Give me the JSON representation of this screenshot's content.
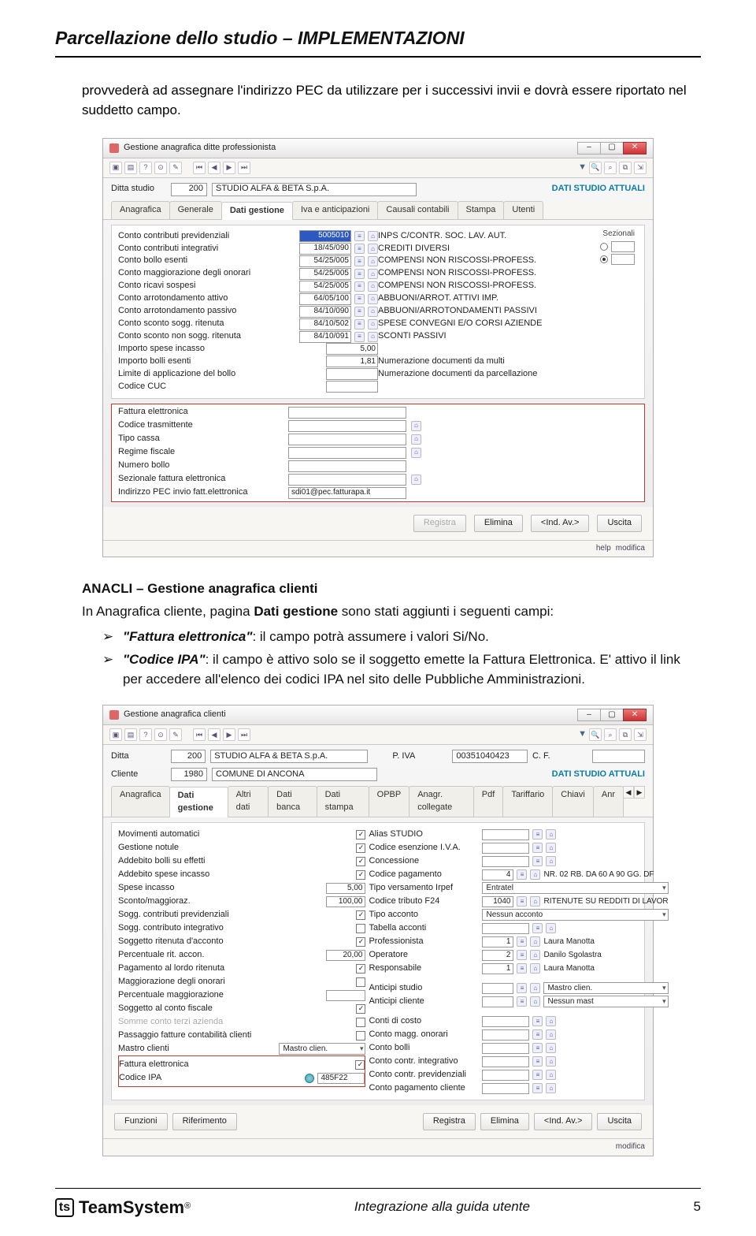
{
  "header": {
    "title": "Parcellazione dello studio – IMPLEMENTAZIONI"
  },
  "intro": "provvederà ad assegnare l'indirizzo PEC da utilizzare per i successivi invii e dovrà essere riportato nel suddetto campo.",
  "shot1": {
    "title": "Gestione anagrafica ditte professionista",
    "ditta_label": "Ditta studio",
    "ditta_code": "200",
    "ditta_name": "STUDIO ALFA & BETA S.p.A.",
    "dati_attuali": "DATI STUDIO ATTUALI",
    "tabs": [
      "Anagrafica",
      "Generale",
      "Dati gestione",
      "Iva e anticipazioni",
      "Causali contabili",
      "Stampa",
      "Utenti"
    ],
    "active_tab": "Dati gestione",
    "rows": [
      {
        "lbl": "Conto contributi previdenziali",
        "code": "5005010",
        "sel": true,
        "desc": "INPS C/CONTR. SOC. LAV. AUT."
      },
      {
        "lbl": "Conto contributi integrativi",
        "code": "18/45/090",
        "desc": "CREDITI DIVERSI"
      },
      {
        "lbl": "Conto bollo esenti",
        "code": "54/25/005",
        "desc": "COMPENSI NON RISCOSSI-PROFESS."
      },
      {
        "lbl": "Conto maggiorazione degli onorari",
        "code": "54/25/005",
        "desc": "COMPENSI NON RISCOSSI-PROFESS."
      },
      {
        "lbl": "Conto ricavi sospesi",
        "code": "54/25/005",
        "desc": "COMPENSI NON RISCOSSI-PROFESS."
      },
      {
        "lbl": "Conto arrotondamento attivo",
        "code": "64/05/100",
        "desc": "ABBUONI/ARROT. ATTIVI IMP."
      },
      {
        "lbl": "Conto arrotondamento passivo",
        "code": "84/10/090",
        "desc": "ABBUONI/ARROTONDAMENTI PASSIVI"
      },
      {
        "lbl": "Conto sconto sogg. ritenuta",
        "code": "84/10/502",
        "desc": "SPESE CONVEGNI E/O CORSI AZIENDE"
      },
      {
        "lbl": "Conto sconto non sogg. ritenuta",
        "code": "84/10/091",
        "desc": "SCONTI PASSIVI"
      },
      {
        "lbl": "Importo spese incasso",
        "code": "5,00",
        "noicon": true,
        "desc": ""
      },
      {
        "lbl": "Importo bolli esenti",
        "code": "1,81",
        "noicon": true,
        "desc": "Numerazione documenti da multi"
      },
      {
        "lbl": "Limite di applicazione del bollo",
        "code": "",
        "noicon": true,
        "desc": "Numerazione documenti da parcellazione"
      },
      {
        "lbl": "Codice CUC",
        "code": "",
        "noicon": true,
        "desc": ""
      }
    ],
    "sezionali_label": "Sezionali",
    "red_fields": [
      {
        "lbl": "Fattura elettronica",
        "val": ""
      },
      {
        "lbl": "Codice trasmittente",
        "val": ""
      },
      {
        "lbl": "Tipo cassa",
        "val": ""
      },
      {
        "lbl": "Regime fiscale",
        "val": ""
      },
      {
        "lbl": "Numero bollo",
        "val": ""
      },
      {
        "lbl": "Sezionale fattura elettronica",
        "val": ""
      },
      {
        "lbl": "Indirizzo PEC invio fatt.elettronica",
        "val": "sdi01@pec.fatturapa.it"
      }
    ],
    "buttons": {
      "registra": "Registra",
      "elimina": "Elimina",
      "indav": "<Ind.   Av.>",
      "uscita": "Uscita"
    },
    "status": [
      "help",
      "modifica"
    ]
  },
  "section2": {
    "title": "ANACLI – Gestione anagrafica clienti",
    "desc_pre": "In Anagrafica cliente, pagina ",
    "desc_bold": "Dati gestione",
    "desc_post": " sono stati aggiunti i seguenti campi:",
    "bullet1": {
      "term": "\"Fattura elettronica\"",
      "rest": ": il campo potrà assumere i valori Si/No."
    },
    "bullet2": {
      "term": "\"Codice IPA\"",
      "rest": ": il campo è attivo solo se il soggetto emette la Fattura Elettronica. E' attivo il link per accedere all'elenco dei codici IPA nel sito delle Pubbliche Amministrazioni."
    }
  },
  "shot2": {
    "title": "Gestione anagrafica clienti",
    "ditta_label": "Ditta",
    "ditta_code": "200",
    "ditta_name": "STUDIO ALFA & BETA S.p.A.",
    "piva_label": "P. IVA",
    "piva": "00351040423",
    "cf_label": "C. F.",
    "cliente_label": "Cliente",
    "cliente_code": "1980",
    "cliente_name": "COMUNE DI ANCONA",
    "dati_attuali": "DATI STUDIO ATTUALI",
    "tabs": [
      "Anagrafica",
      "Dati gestione",
      "Altri dati",
      "Dati banca",
      "Dati stampa",
      "OPBP",
      "Anagr. collegate",
      "Pdf",
      "Tariffario",
      "Chiavi",
      "Anr"
    ],
    "active_tab": "Dati gestione",
    "left_rows": [
      {
        "lbl": "Movimenti automatici",
        "chk": true
      },
      {
        "lbl": "Gestione notule",
        "chk": true
      },
      {
        "lbl": "Addebito bolli su effetti",
        "chk": true
      },
      {
        "lbl": "Addebito spese incasso",
        "chk": true
      },
      {
        "lbl": "Spese incasso",
        "val": "5,00"
      },
      {
        "lbl": "Sconto/maggioraz.",
        "val": "100,00"
      },
      {
        "lbl": "Sogg. contributi previdenziali",
        "chk": true
      },
      {
        "lbl": "Sogg. contributo integrativo",
        "chk": false
      },
      {
        "lbl": "Soggetto ritenuta d'acconto",
        "chk": true
      },
      {
        "lbl": "Percentuale rit. accon.",
        "val": "20,00"
      },
      {
        "lbl": "Pagamento al lordo ritenuta",
        "chk": true
      },
      {
        "lbl": "Maggiorazione degli onorari",
        "chk": false
      },
      {
        "lbl": "Percentuale maggiorazione",
        "val": ""
      },
      {
        "lbl": "Soggetto al conto fiscale",
        "chk": true
      },
      {
        "lbl": "Somme conto terzi azienda",
        "faded": true,
        "chk": false
      },
      {
        "lbl": "Passaggio fatture contabilità clienti",
        "chk": false
      },
      {
        "lbl": "Mastro clienti",
        "dd": "Mastro clien."
      }
    ],
    "left_red": [
      {
        "lbl": "Fattura elettronica",
        "chk": true
      },
      {
        "lbl": "Codice IPA",
        "globe": true,
        "val": "485F22"
      }
    ],
    "right_rows": [
      {
        "lbl": "Alias STUDIO",
        "val": ""
      },
      {
        "lbl": "Codice esenzione I.V.A.",
        "val": ""
      },
      {
        "lbl": "Concessione",
        "val": ""
      },
      {
        "lbl": "Codice pagamento",
        "code": "4",
        "desc": "NR. 02 RB. DA 60 A 90 GG. DF"
      },
      {
        "lbl": "Tipo versamento Irpef",
        "dd": "Entratel"
      },
      {
        "lbl": "Codice tributo F24",
        "code": "1040",
        "desc": "RITENUTE SU REDDITI DI LAVOR"
      },
      {
        "lbl": "Tipo acconto",
        "dd": "Nessun acconto"
      },
      {
        "lbl": "Tabella acconti",
        "val": ""
      },
      {
        "lbl": "Professionista",
        "code": "1",
        "desc": "Laura Manotta"
      },
      {
        "lbl": "Operatore",
        "code": "2",
        "desc": "Danilo Sgolastra"
      },
      {
        "lbl": "Responsabile",
        "code": "1",
        "desc": "Laura Manotta"
      },
      {
        "spacer": true
      },
      {
        "lbl": "Anticipi studio",
        "val": "",
        "dd": "Mastro clien."
      },
      {
        "lbl": "Anticipi cliente",
        "val": "",
        "dd": "Nessun mast"
      },
      {
        "spacer": true
      },
      {
        "lbl": "Conti di costo",
        "val": ""
      },
      {
        "lbl": "Conto magg. onorari",
        "val": ""
      },
      {
        "lbl": "Conto bolli",
        "val": ""
      },
      {
        "lbl": "Conto contr. integrativo",
        "val": ""
      },
      {
        "lbl": "Conto contr. previdenziali",
        "val": ""
      },
      {
        "lbl": "Conto pagamento cliente",
        "val": ""
      }
    ],
    "footer_left": [
      "Funzioni",
      "Riferimento"
    ],
    "buttons": {
      "registra": "Registra",
      "elimina": "Elimina",
      "indav": "<Ind.   Av.>",
      "uscita": "Uscita"
    },
    "status": "modifica"
  },
  "footer": {
    "brand": "TeamSystem",
    "center": "Integrazione alla guida utente",
    "page": "5"
  }
}
